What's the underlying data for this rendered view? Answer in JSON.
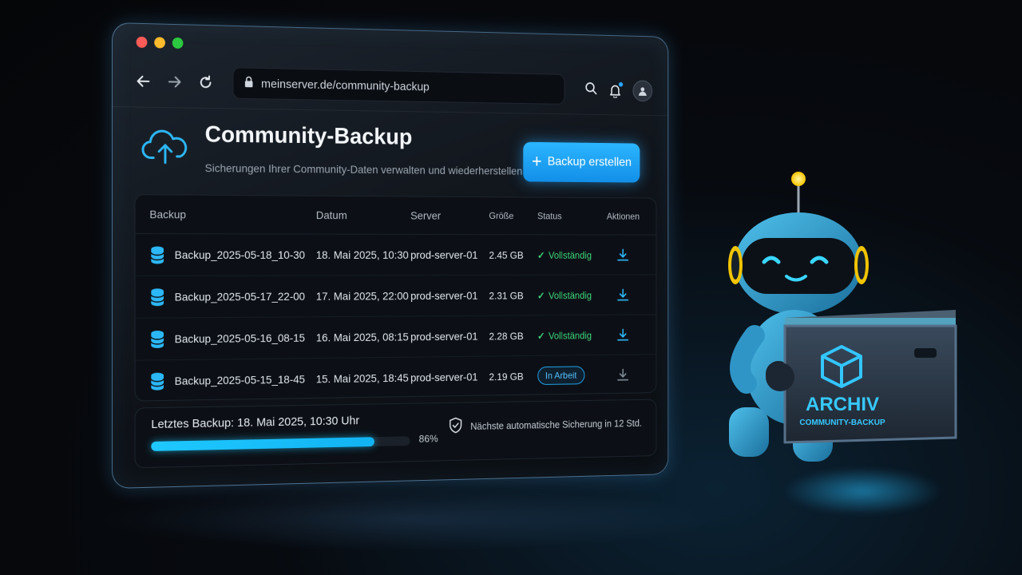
{
  "browser": {
    "url": "meinserver.de/community-backup"
  },
  "header": {
    "title": "Community-Backup",
    "subtitle": "Sicherungen Ihrer Community-Daten verwalten und wiederherstellen.",
    "create_button": "Backup erstellen"
  },
  "table": {
    "columns": [
      "Backup",
      "Datum",
      "Server",
      "Größe",
      "Status",
      "Aktionen"
    ],
    "rows": [
      {
        "name": "Backup_2025-05-18_10-30",
        "date": "18. Mai 2025, 10:30",
        "server": "prod-server-01",
        "size": "2.45 GB",
        "status": "Vollständig",
        "status_type": "complete"
      },
      {
        "name": "Backup_2025-05-17_22-00",
        "date": "17. Mai 2025, 22:00",
        "server": "prod-server-01",
        "size": "2.31 GB",
        "status": "Vollständig",
        "status_type": "complete"
      },
      {
        "name": "Backup_2025-05-16_08-15",
        "date": "16. Mai 2025, 08:15",
        "server": "prod-server-01",
        "size": "2.28 GB",
        "status": "Vollständig",
        "status_type": "complete"
      },
      {
        "name": "Backup_2025-05-15_18-45",
        "date": "15. Mai 2025, 18:45",
        "server": "prod-server-01",
        "size": "2.19 GB",
        "status": "In Arbeit",
        "status_type": "in-progress"
      }
    ]
  },
  "footer": {
    "last_backup": "Letztes Backup: 18. Mai 2025, 10:30 Uhr",
    "progress_percent": 86,
    "progress_label": "86%",
    "next_backup": "Nächste automatische Sicherung in 12 Std."
  },
  "crate": {
    "label": "ARCHIV",
    "sublabel": "COMMUNITY-BACKUP"
  },
  "colors": {
    "accent": "#1ea8f5",
    "success": "#3fd67a",
    "progress": "#1ec8ff"
  }
}
